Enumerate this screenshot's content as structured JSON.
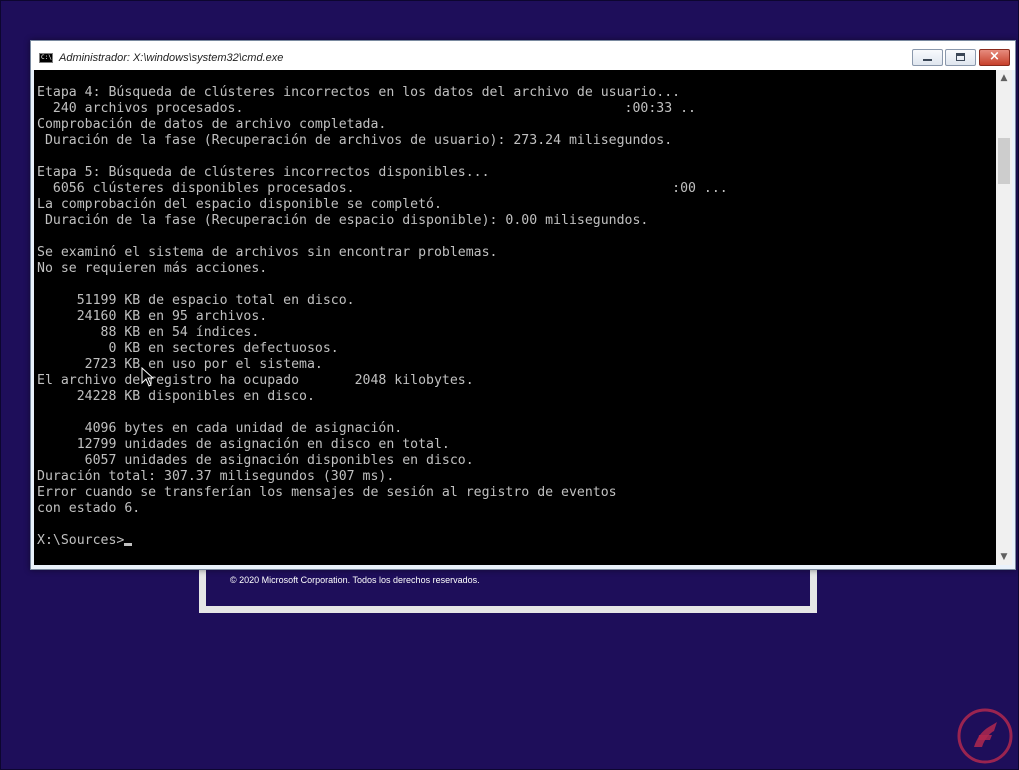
{
  "background_dialog": {
    "copyright": "© 2020 Microsoft Corporation. Todos los derechos reservados."
  },
  "window": {
    "title": "Administrador: X:\\windows\\system32\\cmd.exe",
    "icon_glyph": "C:\\",
    "buttons": {
      "minimize": "minimize-icon",
      "maximize": "maximize-icon",
      "close": "×"
    }
  },
  "console": {
    "text_color": "#c0c0c0",
    "background_color": "#000000",
    "lines": [
      "Etapa 4: Búsqueda de clústeres incorrectos en los datos del archivo de usuario...",
      "  240 archivos procesados.                                                :00:33 ..",
      "Comprobación de datos de archivo completada.",
      " Duración de la fase (Recuperación de archivos de usuario): 273.24 milisegundos.",
      "",
      "Etapa 5: Búsqueda de clústeres incorrectos disponibles...",
      "  6056 clústeres disponibles procesados.                                        :00 ...",
      "La comprobación del espacio disponible se completó.",
      " Duración de la fase (Recuperación de espacio disponible): 0.00 milisegundos.",
      "",
      "Se examinó el sistema de archivos sin encontrar problemas.",
      "No se requieren más acciones.",
      "",
      "     51199 KB de espacio total en disco.",
      "     24160 KB en 95 archivos.",
      "        88 KB en 54 índices.",
      "         0 KB en sectores defectuosos.",
      "      2723 KB en uso por el sistema.",
      "El archivo de registro ha ocupado       2048 kilobytes.",
      "     24228 KB disponibles en disco.",
      "",
      "      4096 bytes en cada unidad de asignación.",
      "     12799 unidades de asignación en disco en total.",
      "      6057 unidades de asignación disponibles en disco.",
      "Duración total: 307.37 milisegundos (307 ms).",
      "Error cuando se transferían los mensajes de sesión al registro de eventos",
      "con estado 6.",
      ""
    ],
    "prompt": "X:\\Sources>"
  },
  "colors": {
    "desktop": "#1e0e5a",
    "close_button": "#c7402b",
    "watermark": "#b0284f"
  }
}
